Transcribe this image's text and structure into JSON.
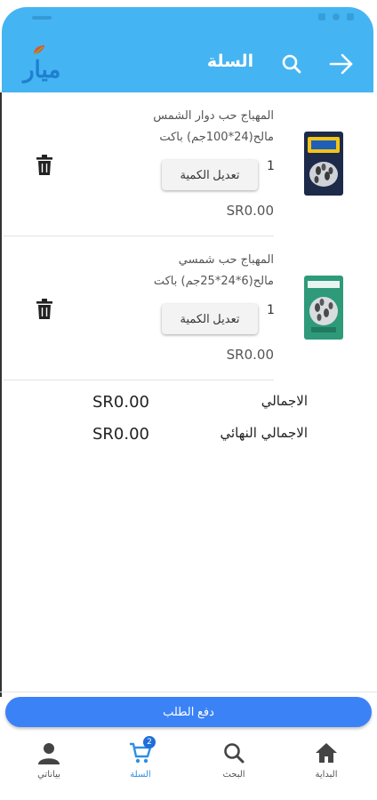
{
  "header": {
    "logo_text": "ميار",
    "title": "السلة",
    "search_icon": "search-icon",
    "back_icon": "arrow-right-icon",
    "color": "#45b4f2"
  },
  "cart": {
    "items": [
      {
        "name_line1": "المهباج حب دوار الشمس",
        "name_line2": "مالح(24*100جم) باكت",
        "quantity": "1",
        "edit_label": "تعديل الكمية",
        "price": "SR0.00",
        "image": "sunflower-seeds-bag-dark"
      },
      {
        "name_line1": "المهباج حب شمسي",
        "name_line2": "مالح(6*24*25جم) باكت",
        "quantity": "1",
        "edit_label": "تعديل الكمية",
        "price": "SR0.00",
        "image": "sunflower-seeds-bag-green"
      }
    ]
  },
  "totals": {
    "subtotal_label": "الاجمالي",
    "subtotal_value": "SR0.00",
    "grand_total_label": "الاجمالي النهائي",
    "grand_total_value": "SR0.00"
  },
  "checkout": {
    "pay_label": "دفع الطلب",
    "color": "#3b82f6"
  },
  "bottom_nav": {
    "items": [
      {
        "label": "بياناتي",
        "icon": "person-icon"
      },
      {
        "label": "السلة",
        "icon": "cart-icon",
        "badge": "2",
        "active": true
      },
      {
        "label": "البحث",
        "icon": "search-icon"
      },
      {
        "label": "البداية",
        "icon": "home-icon"
      }
    ]
  }
}
